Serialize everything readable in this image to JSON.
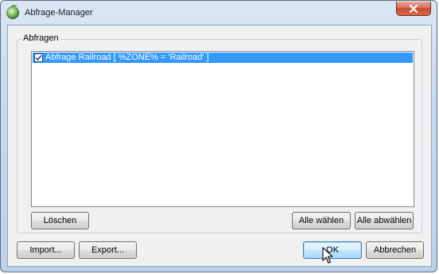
{
  "window": {
    "title": "Abfrage-Manager",
    "close_label": "close"
  },
  "group": {
    "label": "Abfragen"
  },
  "queries": {
    "items": [
      {
        "label": "Abfrage Railroad [ %ZONE%  =  'Railroad' ]",
        "checked": true,
        "selected": true
      }
    ]
  },
  "buttons": {
    "delete": "Löschen",
    "select_all": "Alle wählen",
    "deselect_all": "Alle abwählen",
    "import": "Import...",
    "export": "Export...",
    "ok": "OK",
    "cancel": "Abbrechen"
  },
  "icons": {
    "app": "app-globe-icon",
    "close": "close-x-icon",
    "check": "checkmark-icon",
    "cursor": "mouse-pointer-icon"
  },
  "colors": {
    "selection": "#3399ff",
    "default_button": "#bee6fd",
    "close_button": "#c54a30"
  }
}
